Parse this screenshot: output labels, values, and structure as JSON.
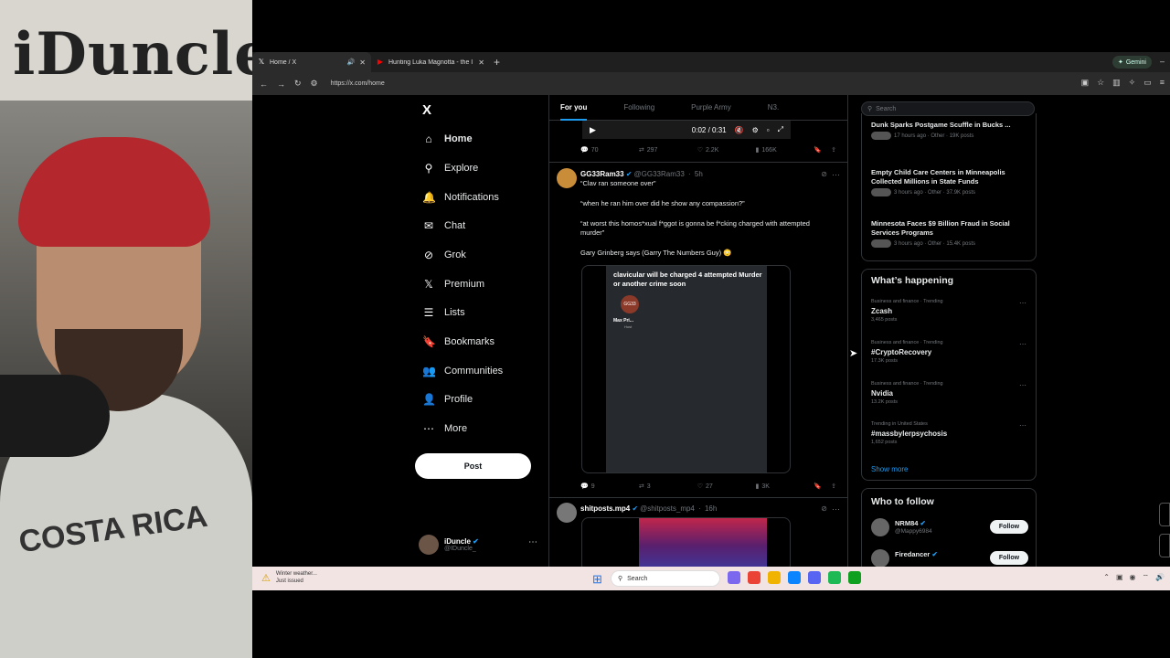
{
  "webcam": {
    "banner_text": "iDuncle",
    "shirt_text": "COSTA RICA"
  },
  "browser": {
    "tabs": [
      {
        "title": "Home / X",
        "active": true
      },
      {
        "title": "Hunting Luka Magnotta - the I",
        "active": false
      }
    ],
    "gemini_label": "Gemini",
    "url": "https://x.com/home"
  },
  "nav": {
    "logo": "X",
    "items": [
      {
        "label": "Home",
        "icon": "home-icon",
        "glyph": "⌂"
      },
      {
        "label": "Explore",
        "icon": "search-icon",
        "glyph": "⚲"
      },
      {
        "label": "Notifications",
        "icon": "bell-icon",
        "glyph": "🔔"
      },
      {
        "label": "Chat",
        "icon": "chat-icon",
        "glyph": "✉"
      },
      {
        "label": "Grok",
        "icon": "grok-icon",
        "glyph": "⊘"
      },
      {
        "label": "Premium",
        "icon": "x-icon",
        "glyph": "𝕏"
      },
      {
        "label": "Lists",
        "icon": "list-icon",
        "glyph": "☰"
      },
      {
        "label": "Bookmarks",
        "icon": "bookmark-icon",
        "glyph": "🔖"
      },
      {
        "label": "Communities",
        "icon": "people-icon",
        "glyph": "👥"
      },
      {
        "label": "Profile",
        "icon": "person-icon",
        "glyph": "👤"
      },
      {
        "label": "More",
        "icon": "more-icon",
        "glyph": "⋯"
      }
    ],
    "post_label": "Post",
    "profile": {
      "name": "iDuncle",
      "handle": "@IDuncle_"
    }
  },
  "feed": {
    "tabs": [
      "For you",
      "Following",
      "Purple Army",
      "N3."
    ],
    "video_time": "0:02 / 0:31",
    "post1_stats": {
      "replies": "70",
      "reposts": "297",
      "likes": "2.2K",
      "views": "166K"
    },
    "post2": {
      "name": "GG33Ram33",
      "handle": "@GG33Ram33",
      "time": "5h",
      "lines": [
        "“Clav ran someone over”",
        "“when he ran him over did he show any compassion?”",
        "“at worst this homos*xual f*ggot is gonna be f*cking charged with attempted murder”",
        "Gary Grinberg says (Garry The Numbers Guy) 😳"
      ],
      "media_caption": "clavicular will be charged 4 attempted Murder or another crime soon",
      "media_logo": "GG33",
      "media_name": "Max Pri...",
      "media_host": "Host",
      "stats": {
        "replies": "9",
        "reposts": "3",
        "likes": "27",
        "views": "3K"
      }
    },
    "post3": {
      "name": "shitposts.mp4",
      "handle": "@shitposts_mp4",
      "time": "16h"
    }
  },
  "right": {
    "search_placeholder": "Search",
    "news": [
      {
        "title": "Dunk Sparks Postgame Scuffle in Bucks ...",
        "meta": "17 hours ago · Other · 19K posts"
      },
      {
        "title": "Empty Child Care Centers in Minneapolis Collected Millions in State Funds",
        "meta": "3 hours ago · Other · 37.9K posts"
      },
      {
        "title": "Minnesota Faces $9 Billion Fraud in Social Services Programs",
        "meta": "3 hours ago · Other · 15.4K posts"
      }
    ],
    "happening_title": "What’s happening",
    "trends": [
      {
        "category": "Business and finance · Trending",
        "name": "Zcash",
        "posts": "3,465 posts"
      },
      {
        "category": "Business and finance · Trending",
        "name": "#CryptoRecovery",
        "posts": "17.3K posts"
      },
      {
        "category": "Business and finance · Trending",
        "name": "Nvidia",
        "posts": "13.2K posts"
      },
      {
        "category": "Trending in United States",
        "name": "#massbylerpsychosis",
        "posts": "1,652 posts"
      }
    ],
    "show_more": "Show more",
    "who_title": "Who to follow",
    "who": [
      {
        "name": "NRM84",
        "handle": "@Mappy6984",
        "follow": "Follow"
      },
      {
        "name": "Firedancer",
        "handle": "",
        "follow": "Follow"
      }
    ]
  },
  "taskbar": {
    "weather_title": "Winter weather...",
    "weather_sub": "Just issued",
    "search_placeholder": "Search"
  }
}
